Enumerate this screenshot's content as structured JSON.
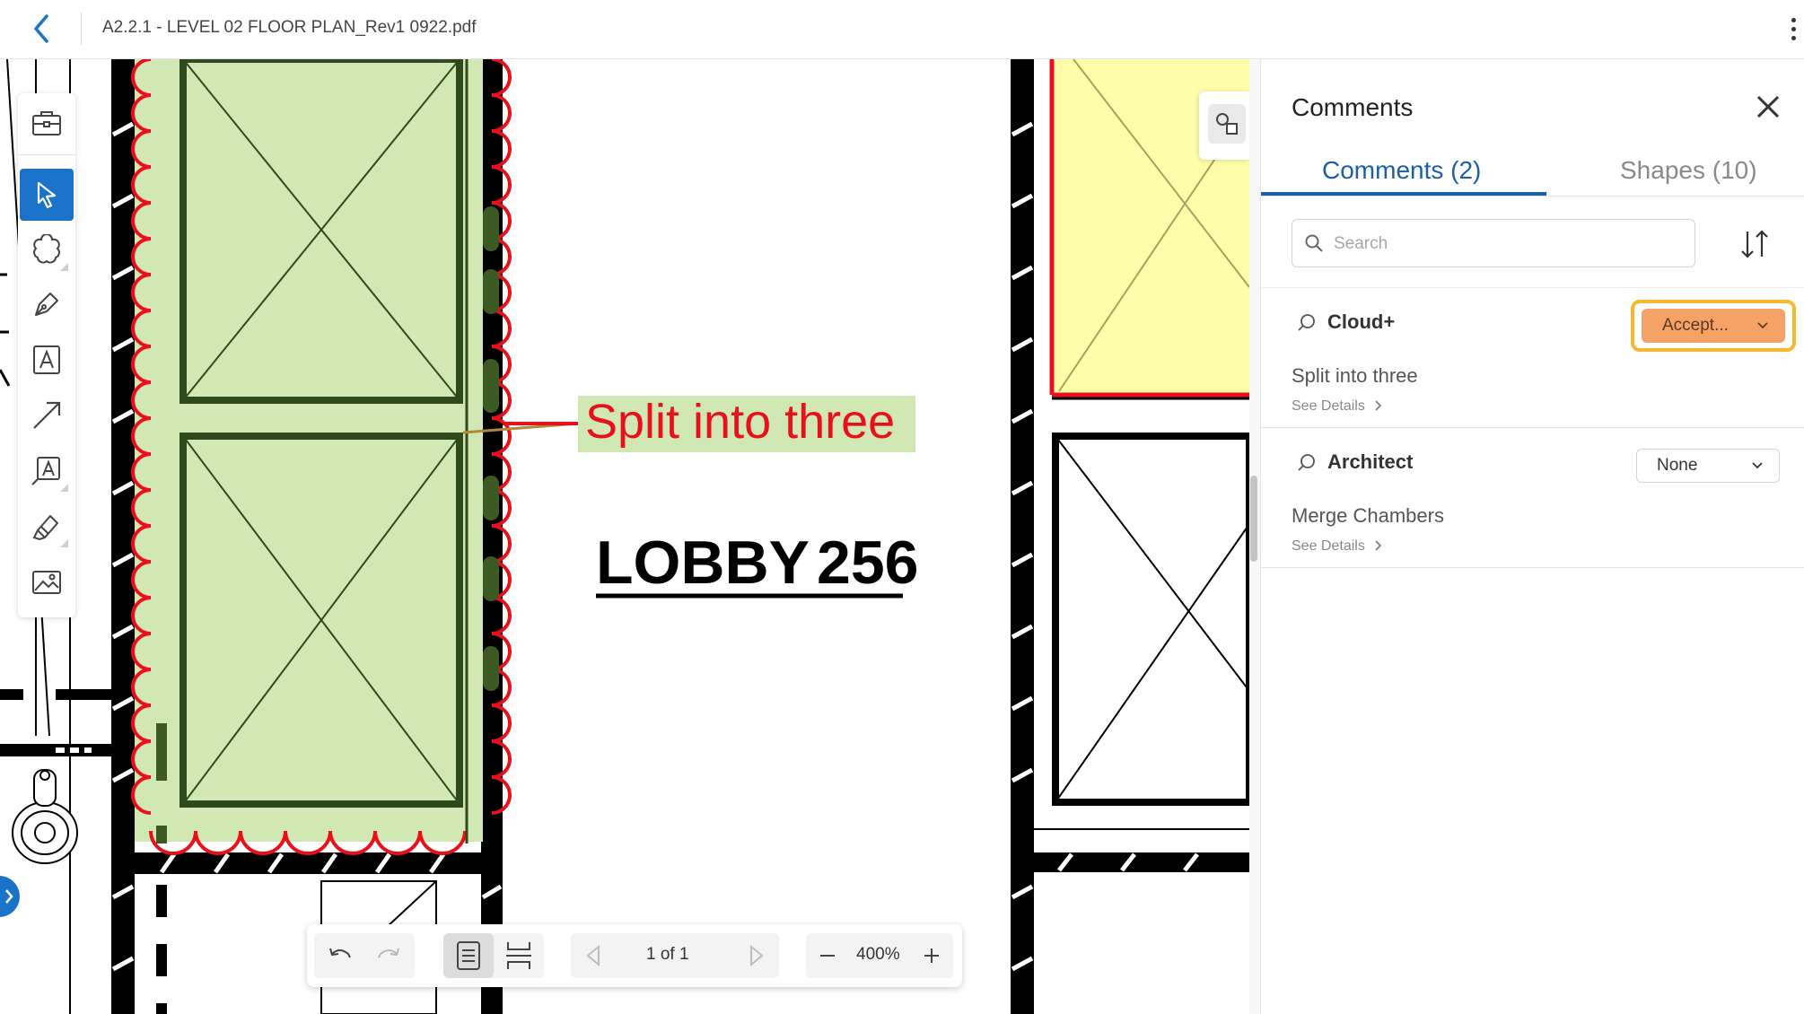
{
  "header": {
    "file_title": "A2.2.1 - LEVEL 02 FLOOR PLAN_Rev1 0922.pdf"
  },
  "drawing": {
    "callout_text": "Split into three",
    "room_label": "LOBBY",
    "room_number": "256"
  },
  "toolbar": {
    "page_indicator": "1 of 1",
    "zoom_level": "400%"
  },
  "panel": {
    "title": "Comments",
    "tabs": [
      {
        "label": "Comments (2)",
        "active": true
      },
      {
        "label": "Shapes (10)",
        "active": false
      }
    ],
    "search": {
      "placeholder": "Search",
      "value": ""
    },
    "comments": [
      {
        "author": "Cloud+",
        "text": "Split into three",
        "status": "Accept...",
        "details_label": "See Details"
      },
      {
        "author": "Architect",
        "text": "Merge Chambers",
        "status": "None",
        "details_label": "See Details"
      }
    ]
  },
  "colors": {
    "accent": "#1a73c9",
    "tab_active": "#1a5fa8",
    "markup_red": "#e8101a",
    "cloud_fill": "#d2e8b4",
    "highlight_yellow": "#fefeaa",
    "accepted_status": "#f6a266",
    "focus_ring": "#f5b82e"
  },
  "icons": [
    "back-arrow-icon",
    "more-vertical-icon",
    "briefcase-icon",
    "pointer-icon",
    "cloud-icon",
    "pen-icon",
    "text-icon",
    "arrow-line-icon",
    "callout-icon",
    "highlighter-icon",
    "image-icon",
    "shapes-icon",
    "undo-icon",
    "redo-icon",
    "single-page-icon",
    "continuous-page-icon",
    "prev-page-icon",
    "next-page-icon",
    "zoom-out-icon",
    "zoom-in-icon",
    "close-icon",
    "search-icon",
    "sort-icon",
    "comment-icon",
    "chevron-down-icon",
    "chevron-right-icon"
  ]
}
